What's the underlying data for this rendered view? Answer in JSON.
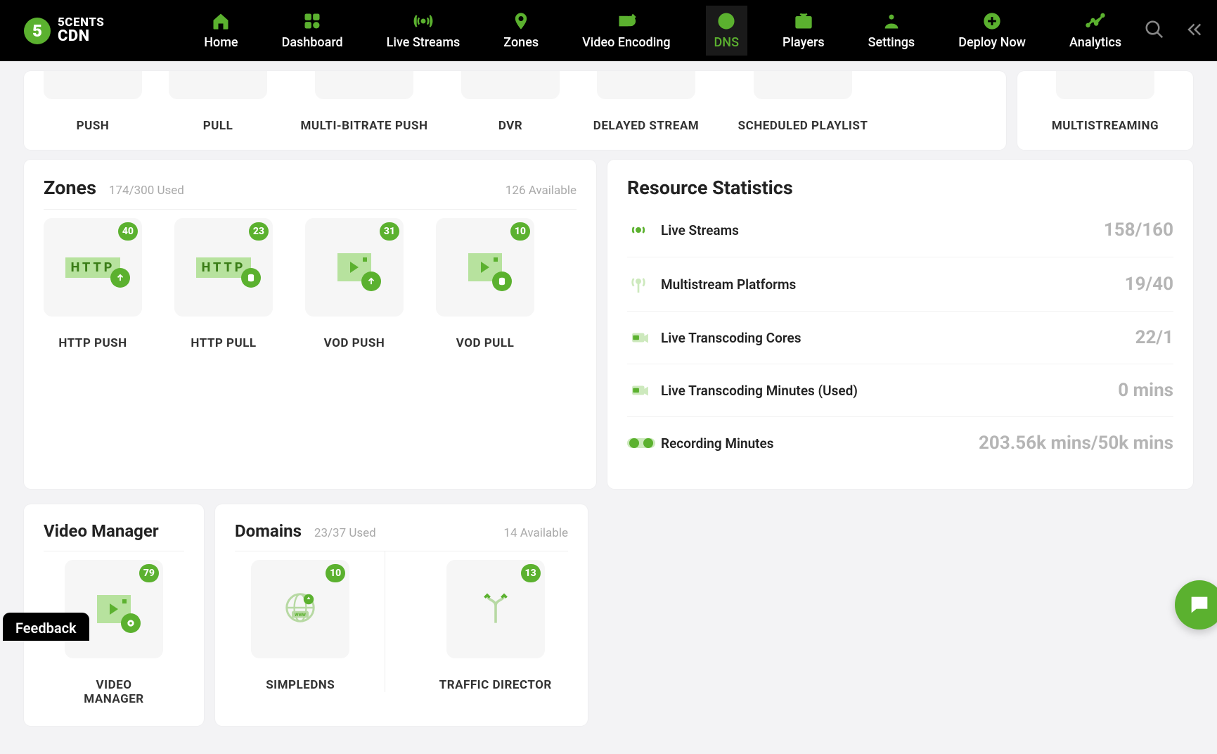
{
  "brand": {
    "line1": "5CENTS",
    "line2": "CDN"
  },
  "nav": {
    "items": [
      {
        "label": "Home"
      },
      {
        "label": "Dashboard"
      },
      {
        "label": "Live Streams"
      },
      {
        "label": "Zones"
      },
      {
        "label": "Video Encoding"
      },
      {
        "label": "DNS",
        "active": true
      },
      {
        "label": "Players"
      },
      {
        "label": "Settings"
      },
      {
        "label": "Deploy Now"
      },
      {
        "label": "Analytics"
      }
    ]
  },
  "top_strip": {
    "items": [
      {
        "label": "PUSH"
      },
      {
        "label": "PULL"
      },
      {
        "label": "MULTI-BITRATE PUSH"
      },
      {
        "label": "DVR"
      },
      {
        "label": "DELAYED STREAM"
      },
      {
        "label": "SCHEDULED PLAYLIST"
      }
    ],
    "right_items": [
      {
        "label": "MULTISTREAMING"
      }
    ]
  },
  "zones": {
    "title": "Zones",
    "used": "174/300 Used",
    "available": "126 Available",
    "tiles": [
      {
        "label": "HTTP PUSH",
        "count": "40"
      },
      {
        "label": "HTTP PULL",
        "count": "23"
      },
      {
        "label": "VOD PUSH",
        "count": "31"
      },
      {
        "label": "VOD PULL",
        "count": "10"
      }
    ]
  },
  "video_manager": {
    "title": "Video Manager",
    "tiles": [
      {
        "label": "VIDEO MANAGER",
        "count": "79"
      }
    ]
  },
  "domains": {
    "title": "Domains",
    "used": "23/37 Used",
    "available": "14 Available",
    "tiles": [
      {
        "label": "SIMPLEDNS",
        "count": "10"
      },
      {
        "label": "TRAFFIC DIRECTOR",
        "count": "13"
      }
    ]
  },
  "stats": {
    "title": "Resource Statistics",
    "rows": [
      {
        "label": "Live Streams",
        "value": "158/160"
      },
      {
        "label": "Multistream Platforms",
        "value": "19/40"
      },
      {
        "label": "Live Transcoding Cores",
        "value": "22/1"
      },
      {
        "label": "Live Transcoding Minutes (Used)",
        "value": "0 mins"
      },
      {
        "label": "Recording Minutes",
        "value": "203.56k mins/50k mins"
      }
    ]
  },
  "feedback_label": "Feedback"
}
